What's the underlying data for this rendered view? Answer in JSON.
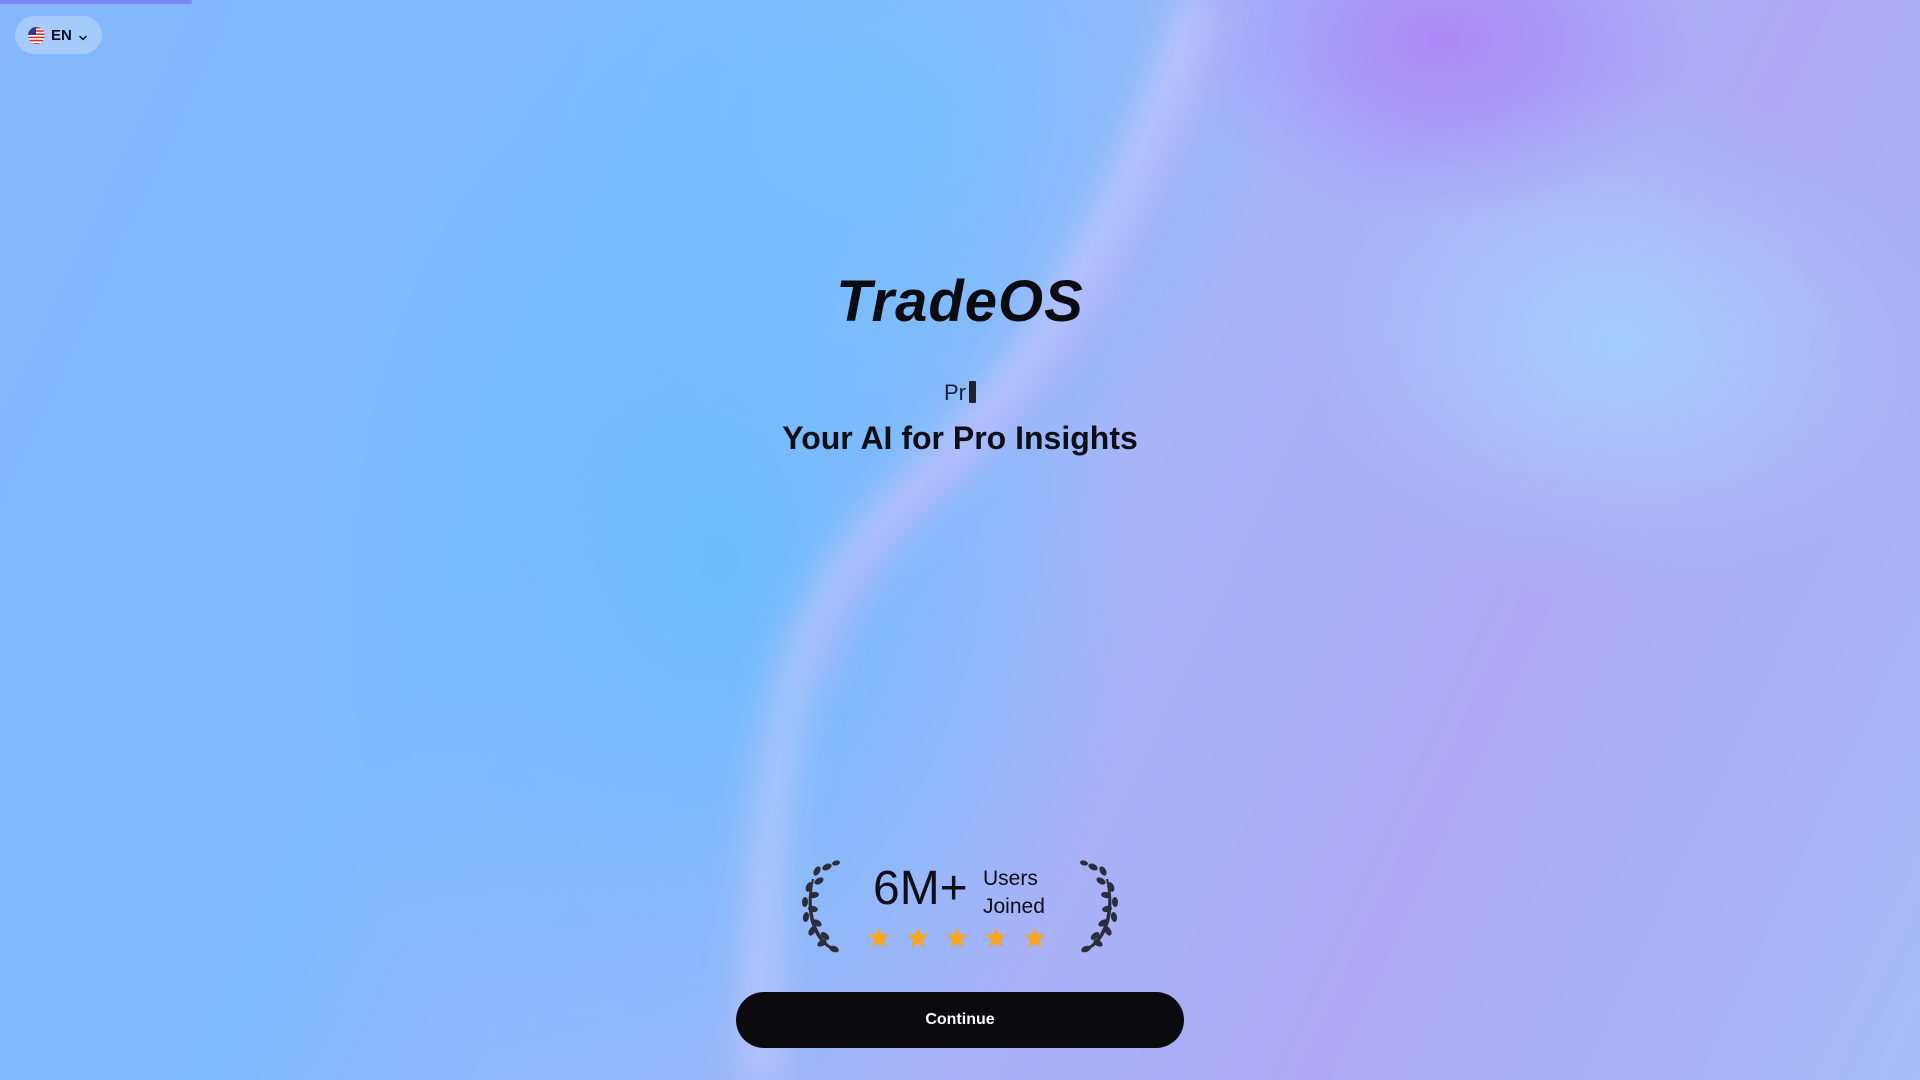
{
  "language_selector": {
    "label": "EN",
    "flag_icon": "us-flag-icon",
    "chevron_icon": "chevron-down-icon"
  },
  "loading_progress": 0.1,
  "brand": {
    "name": "TradeOS"
  },
  "hero": {
    "typing_text": "Pr",
    "tagline": "Your AI for Pro Insights"
  },
  "social_proof": {
    "count": "6M+",
    "label_line1": "Users",
    "label_line2": "Joined",
    "rating_stars": 5,
    "star_color": "#f6a623",
    "laurel_icon": "laurel-wreath-icon"
  },
  "cta": {
    "continue_label": "Continue"
  },
  "colors": {
    "accent_bar": "#7b86f0",
    "button_bg": "#0a0a0f"
  }
}
